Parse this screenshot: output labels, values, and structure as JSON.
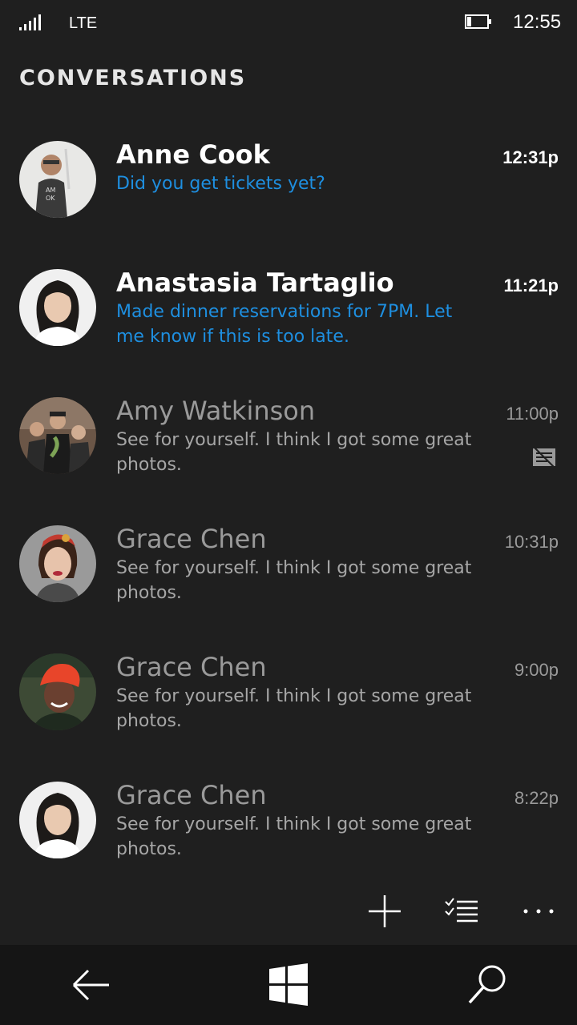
{
  "status_bar": {
    "network": "LTE",
    "time": "12:55",
    "icons": [
      "signal-bars-icon",
      "battery-icon"
    ]
  },
  "page": {
    "title": "CONVERSATIONS"
  },
  "conversations": [
    {
      "name": "Anne Cook",
      "message": "Did you get tickets yet?",
      "time": "12:31p",
      "unread": true,
      "draft": false
    },
    {
      "name": "Anastasia Tartaglio",
      "message": "Made dinner reservations for 7PM. Let me know if this is too late.",
      "time": "11:21p",
      "unread": true,
      "draft": false
    },
    {
      "name": "Amy Watkinson",
      "message": "See for yourself. I think I got some great photos.",
      "time": "11:00p",
      "unread": false,
      "draft": true
    },
    {
      "name": "Grace Chen",
      "message": "See for yourself. I think I got some great photos.",
      "time": "10:31p",
      "unread": false,
      "draft": false
    },
    {
      "name": "Grace Chen",
      "message": "See for yourself. I think I got some great photos.",
      "time": "9:00p",
      "unread": false,
      "draft": false
    },
    {
      "name": "Grace Chen",
      "message": "See for yourself. I think I got some great photos.",
      "time": "8:22p",
      "unread": false,
      "draft": false
    }
  ],
  "app_bar": {
    "icons": [
      "new-conversation-icon",
      "select-icon",
      "more-icon"
    ]
  },
  "nav_bar": {
    "icons": [
      "back-arrow-icon",
      "windows-logo-icon",
      "search-icon"
    ]
  },
  "colors": {
    "background": "#1f1f1f",
    "accent": "#1e8fe0",
    "unread_text": "#ffffff",
    "read_text": "#9a9a9a"
  }
}
